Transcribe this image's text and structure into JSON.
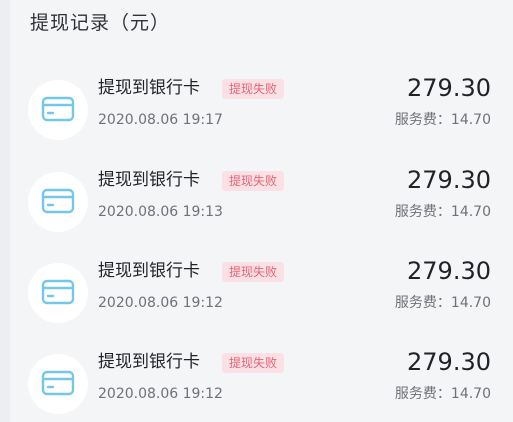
{
  "header": {
    "title": "提现记录（元）"
  },
  "colors": {
    "background": "#f4f5f7",
    "icon_accent": "#73c8ea",
    "badge_bg": "#fbe1e4",
    "badge_text": "#e5657a"
  },
  "records": [
    {
      "icon": "bank-card-icon",
      "title": "提现到银行卡",
      "status": "提现失败",
      "datetime": "2020.08.06 19:17",
      "amount": "279.30",
      "fee": "服务费：14.70"
    },
    {
      "icon": "bank-card-icon",
      "title": "提现到银行卡",
      "status": "提现失败",
      "datetime": "2020.08.06 19:13",
      "amount": "279.30",
      "fee": "服务费：14.70"
    },
    {
      "icon": "bank-card-icon",
      "title": "提现到银行卡",
      "status": "提现失败",
      "datetime": "2020.08.06 19:12",
      "amount": "279.30",
      "fee": "服务费：14.70"
    },
    {
      "icon": "bank-card-icon",
      "title": "提现到银行卡",
      "status": "提现失败",
      "datetime": "2020.08.06 19:12",
      "amount": "279.30",
      "fee": "服务费：14.70"
    }
  ]
}
